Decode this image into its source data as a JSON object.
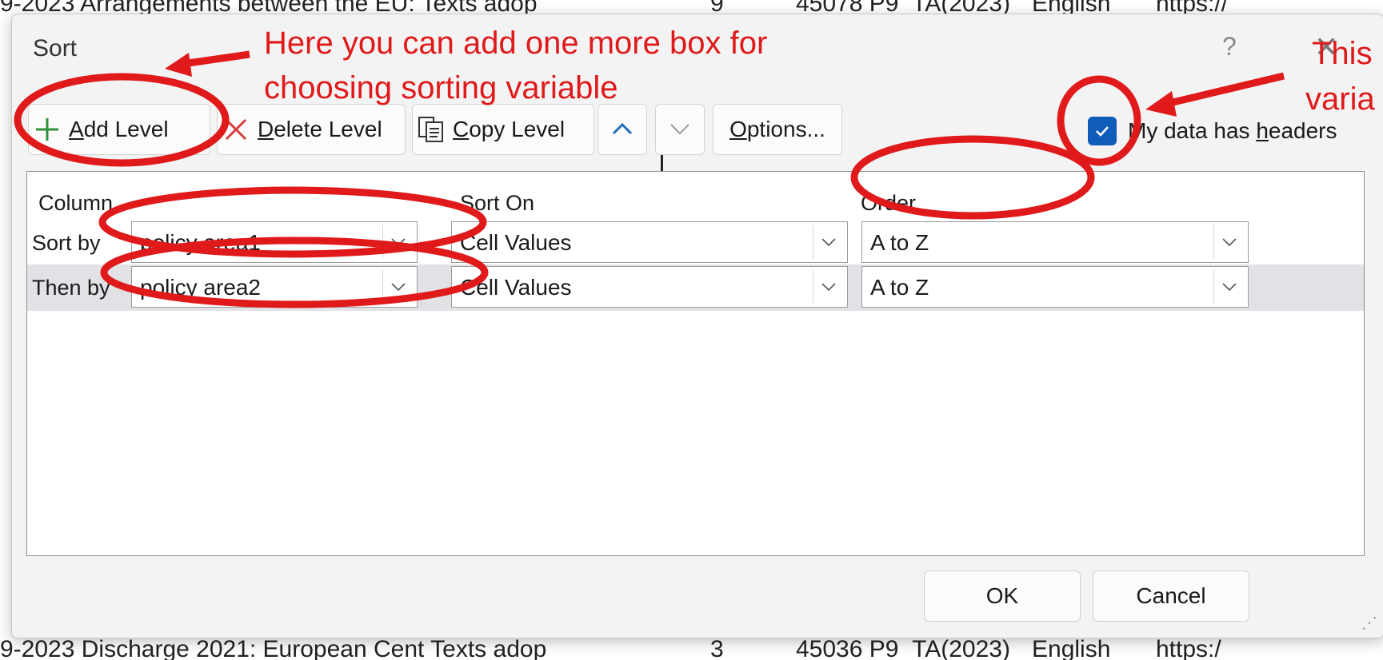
{
  "background": {
    "top_fragments": [
      "9-2023 Arrangements between the EU: Texts adop",
      "9",
      "45078 P9_TA(2023)",
      "English",
      "https://"
    ],
    "bottom_fragments": [
      "9-2023 Discharge 2021: European Cent Texts adop",
      "3",
      "45036 P9_TA(2023)",
      "English",
      "https:/"
    ]
  },
  "dialog": {
    "title": "Sort",
    "help_glyph": "?",
    "close_glyph": "✕"
  },
  "toolbar": {
    "add_level_accel": "A",
    "add_level_rest": "dd Level",
    "delete_level_accel": "D",
    "delete_level_rest": "elete Level",
    "copy_level_accel": "C",
    "copy_level_rest": "opy Level",
    "options_accel": "O",
    "options_rest": "ptions...",
    "headers_pre": "My data has ",
    "headers_accel": "h",
    "headers_post": "eaders",
    "headers_checked": true
  },
  "grid": {
    "headers": {
      "column": "Column",
      "sort_on": "Sort On",
      "order": "Order"
    },
    "rows": [
      {
        "label": "Sort by",
        "column": "policy area1",
        "sort_on": "Cell Values",
        "order": "A to Z"
      },
      {
        "label": "Then by",
        "column": "policy area2",
        "sort_on": "Cell Values",
        "order": "A to Z"
      }
    ]
  },
  "footer": {
    "ok": "OK",
    "cancel": "Cancel"
  },
  "annotations": {
    "add_level_note_line1": "Here you can add one more box for",
    "add_level_note_line2": "choosing sorting variable",
    "right_note_line1": "This",
    "right_note_line2": "varia",
    "color": "#e0191a"
  },
  "colors": {
    "checkbox": "#0f5cbb",
    "add_icon": "#2f8f3a",
    "delete_icon": "#d83b3b",
    "arrow_up": "#1f6fb8"
  }
}
